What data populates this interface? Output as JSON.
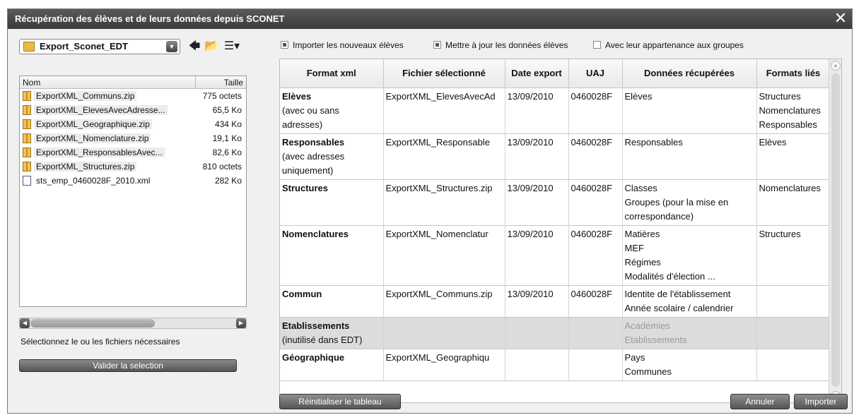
{
  "window": {
    "title": "Récupération des élèves et de leurs données depuis SCONET"
  },
  "left": {
    "folder": "Export_Sconet_EDT",
    "columns": {
      "name": "Nom",
      "size": "Taille"
    },
    "files": [
      {
        "name": "ExportXML_Communs.zip",
        "size": "775 octets",
        "type": "zip",
        "highlight": true
      },
      {
        "name": "ExportXML_ElevesAvecAdresse...",
        "size": "65,5 Ko",
        "type": "zip",
        "highlight": true
      },
      {
        "name": "ExportXML_Geographique.zip",
        "size": "434 Ko",
        "type": "zip",
        "highlight": true
      },
      {
        "name": "ExportXML_Nomenclature.zip",
        "size": "19,1 Ko",
        "type": "zip",
        "highlight": true
      },
      {
        "name": "ExportXML_ResponsablesAvec...",
        "size": "82,6 Ko",
        "type": "zip",
        "highlight": true
      },
      {
        "name": "ExportXML_Structures.zip",
        "size": "810 octets",
        "type": "zip",
        "highlight": true
      },
      {
        "name": "sts_emp_0460028F_2010.xml",
        "size": "282 Ko",
        "type": "xml",
        "highlight": false
      }
    ],
    "hint": "Sélectionnez le ou les fichiers nécessaires",
    "validate_label": "Valider la selection"
  },
  "options": {
    "import_new": {
      "label": "Importer les nouveaux élèves",
      "checked": true
    },
    "update": {
      "label": "Mettre à jour les données élèves",
      "checked": true
    },
    "groups": {
      "label": "Avec leur appartenance aux groupes",
      "checked": false
    }
  },
  "table": {
    "headers": [
      "Format xml",
      "Fichier sélectionné",
      "Date export",
      "UAJ",
      "Données récupérées",
      "Formats liés"
    ],
    "rows": [
      {
        "format": "Elèves",
        "format_sub": [
          "(avec ou sans",
          "adresses)"
        ],
        "file": "ExportXML_ElevesAvecAd",
        "date": "13/09/2010",
        "uaj": "0460028F",
        "data": [
          "Elèves"
        ],
        "linked": [
          "Structures",
          "Nomenclatures",
          "Responsables"
        ],
        "disabled": false
      },
      {
        "format": "Responsables",
        "format_sub": [
          "(avec adresses",
          "uniquement)"
        ],
        "file": "ExportXML_Responsable",
        "date": "13/09/2010",
        "uaj": "0460028F",
        "data": [
          "Responsables"
        ],
        "linked": [
          "Elèves"
        ],
        "disabled": false
      },
      {
        "format": "Structures",
        "format_sub": [],
        "file": "ExportXML_Structures.zip",
        "date": "13/09/2010",
        "uaj": "0460028F",
        "data": [
          "Classes",
          "Groupes (pour la mise en",
          "correspondance)"
        ],
        "linked": [
          "Nomenclatures"
        ],
        "disabled": false
      },
      {
        "format": "Nomenclatures",
        "format_sub": [],
        "file": "ExportXML_Nomenclatur",
        "date": "13/09/2010",
        "uaj": "0460028F",
        "data": [
          "Matières",
          "MEF",
          "Régimes",
          "Modalités d'élection ..."
        ],
        "linked": [
          "Structures"
        ],
        "disabled": false
      },
      {
        "format": "Commun",
        "format_sub": [],
        "file": "ExportXML_Communs.zip",
        "date": "13/09/2010",
        "uaj": "0460028F",
        "data": [
          "Identite de l'établissement",
          "Année scolaire / calendrier"
        ],
        "linked": [],
        "disabled": false
      },
      {
        "format": "Etablissements",
        "format_sub": [
          "(inutilisé dans EDT)"
        ],
        "file": "",
        "date": "",
        "uaj": "",
        "data": [
          "Académies",
          "Etablissements"
        ],
        "linked": [],
        "disabled": true
      },
      {
        "format": "Géographique",
        "format_sub": [],
        "file": "ExportXML_Geographiqu",
        "date": "",
        "uaj": "",
        "data": [
          "Pays",
          "Communes"
        ],
        "linked": [],
        "disabled": false
      }
    ]
  },
  "buttons": {
    "reset": "Réinitialiser le tableau",
    "cancel": "Annuler",
    "import": "Importer"
  },
  "colors": {
    "titlebar": "#4a4a4a",
    "button": "#6e6e6e",
    "disabled_row": "#dcdcdc",
    "folder": "#e8b84a"
  },
  "icons": {
    "close": "close-icon",
    "back": "back-arrow-icon",
    "up_folder": "up-folder-icon",
    "view": "view-menu-icon"
  }
}
